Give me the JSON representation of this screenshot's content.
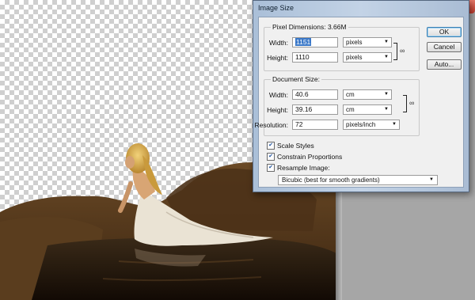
{
  "window": {
    "close_glyph": "✕"
  },
  "dialog": {
    "title": "Image Size",
    "pixel_dimensions": {
      "legend": "Pixel Dimensions:",
      "size": "3.66M",
      "width_label": "Width:",
      "width_value": "1151",
      "width_unit": "pixels",
      "height_label": "Height:",
      "height_value": "1110",
      "height_unit": "pixels",
      "link_icon": "chain-link-icon"
    },
    "document_size": {
      "legend": "Document Size:",
      "width_label": "Width:",
      "width_value": "40.6",
      "width_unit": "cm",
      "height_label": "Height:",
      "height_value": "39.16",
      "height_unit": "cm",
      "resolution_label": "Resolution:",
      "resolution_value": "72",
      "resolution_unit": "pixels/inch",
      "link_icon": "chain-link-icon"
    },
    "options": {
      "scale_styles": {
        "label": "Scale Styles",
        "checked": true
      },
      "constrain_proportions": {
        "label": "Constrain Proportions",
        "checked": true
      },
      "resample_image": {
        "label": "Resample Image:",
        "checked": true
      },
      "resample_method": "Bicubic (best for smooth gradients)"
    },
    "buttons": {
      "ok": "OK",
      "cancel": "Cancel",
      "auto": "Auto..."
    }
  },
  "colors": {
    "selection": "#3a78c8",
    "dialog_frame": "#aabfd8",
    "pasteboard": "#a6a6a6"
  }
}
